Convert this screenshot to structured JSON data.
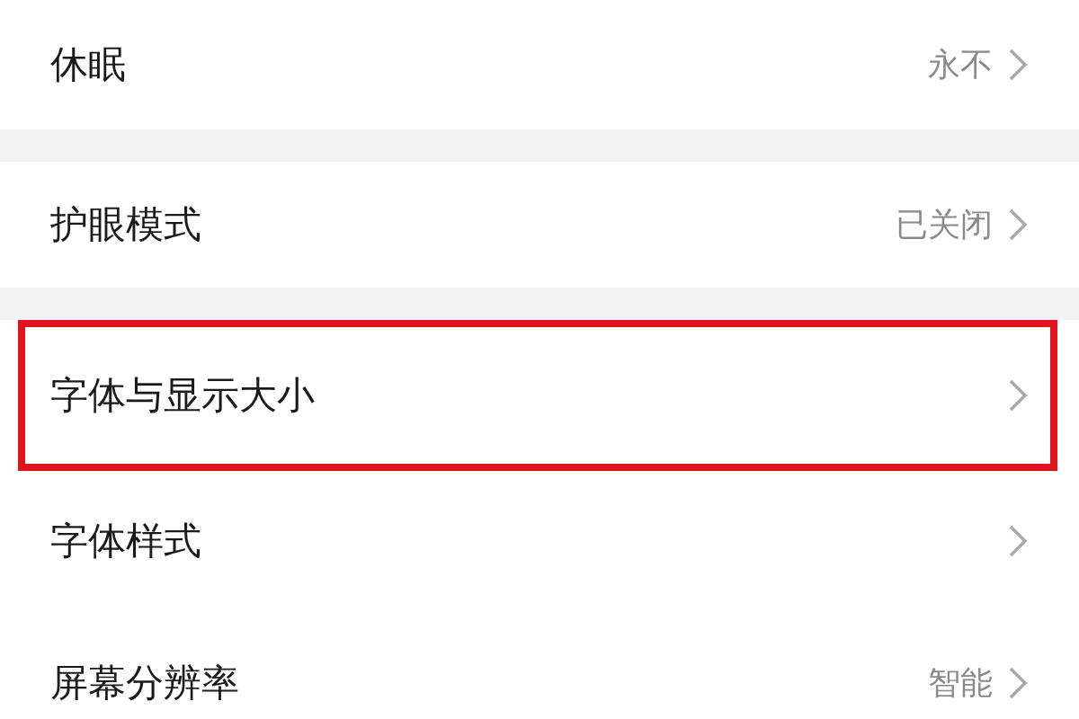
{
  "groups": [
    {
      "rows": [
        {
          "label": "休眠",
          "value": "永不",
          "highlighted": false
        }
      ]
    },
    {
      "rows": [
        {
          "label": "护眼模式",
          "value": "已关闭",
          "highlighted": false
        }
      ]
    },
    {
      "rows": [
        {
          "label": "字体与显示大小",
          "highlighted": true
        },
        {
          "label": "字体样式",
          "highlighted": false
        },
        {
          "label": "屏幕分辨率",
          "value": "智能",
          "highlighted": false
        }
      ]
    }
  ]
}
